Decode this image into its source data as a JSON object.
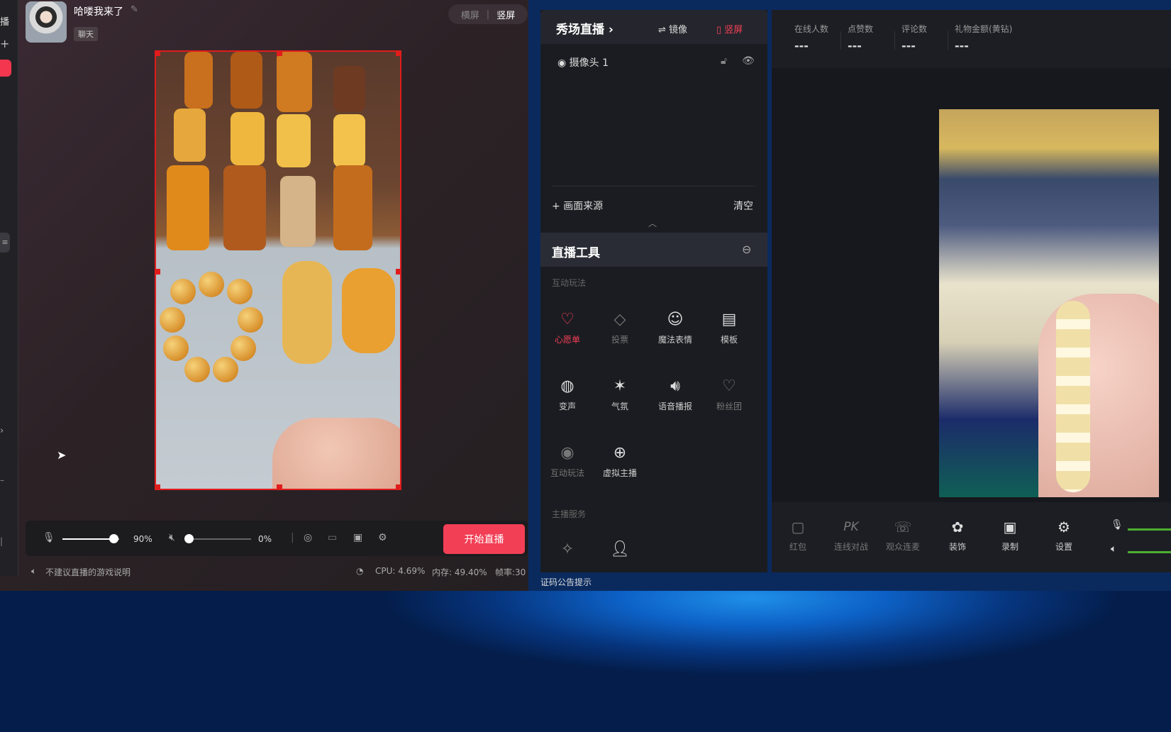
{
  "left": {
    "strip_label": "播",
    "user_name": "哈喽我来了",
    "chat_tag": "聊天",
    "orientation": {
      "landscape": "横屏",
      "portrait": "竖屏"
    },
    "mic_volume": "90%",
    "speaker_volume": "0%",
    "mic_level": 0.9,
    "speaker_level": 0.0,
    "start_button": "开始直播",
    "status": {
      "hint": "不建议直播的游戏说明",
      "cpu": "CPU: 4.69%",
      "mem": "内存: 49.40%",
      "fps": "帧率:30"
    }
  },
  "scene": {
    "title": "秀场直播",
    "mirror": "镜像",
    "vertical": "竖屏",
    "camera": "摄像头 1",
    "add_source": "画面来源",
    "clear": "清空"
  },
  "tools": {
    "title": "直播工具",
    "section_interactive": "互动玩法",
    "section_host": "主播服务",
    "items": [
      {
        "label": "心愿单",
        "icon": "heart-icon",
        "state": "active"
      },
      {
        "label": "投票",
        "icon": "vote-icon",
        "state": "dim"
      },
      {
        "label": "魔法表情",
        "icon": "smile-icon",
        "state": "normal"
      },
      {
        "label": "模板",
        "icon": "template-icon",
        "state": "normal"
      },
      {
        "label": "变声",
        "icon": "voice-icon",
        "state": "normal"
      },
      {
        "label": "气氛",
        "icon": "atmosphere-icon",
        "state": "normal"
      },
      {
        "label": "语音播报",
        "icon": "speaker-icon",
        "state": "normal"
      },
      {
        "label": "粉丝团",
        "icon": "fan-heart-icon",
        "state": "dim"
      },
      {
        "label": "互动玩法",
        "icon": "game-icon",
        "state": "dim"
      },
      {
        "label": "虚拟主播",
        "icon": "virtual-host-icon",
        "state": "normal"
      }
    ],
    "notice": "证码公告提示"
  },
  "stats": [
    {
      "label": "在线人数",
      "value": "---"
    },
    {
      "label": "点赞数",
      "value": "---"
    },
    {
      "label": "评论数",
      "value": "---"
    },
    {
      "label": "礼物金额(黄钻)",
      "value": "---"
    }
  ],
  "bottom_tools": [
    {
      "label": "红包",
      "icon": "redpacket-icon",
      "state": "dim"
    },
    {
      "label": "连线对战",
      "icon": "pk-icon",
      "state": "dim"
    },
    {
      "label": "观众连麦",
      "icon": "call-icon",
      "state": "dim"
    },
    {
      "label": "装饰",
      "icon": "decoration-icon",
      "state": "normal"
    },
    {
      "label": "录制",
      "icon": "record-icon",
      "state": "normal"
    },
    {
      "label": "设置",
      "icon": "settings-icon",
      "state": "normal"
    }
  ],
  "colors": {
    "accent": "#f23f55",
    "level": "#4caf30"
  }
}
